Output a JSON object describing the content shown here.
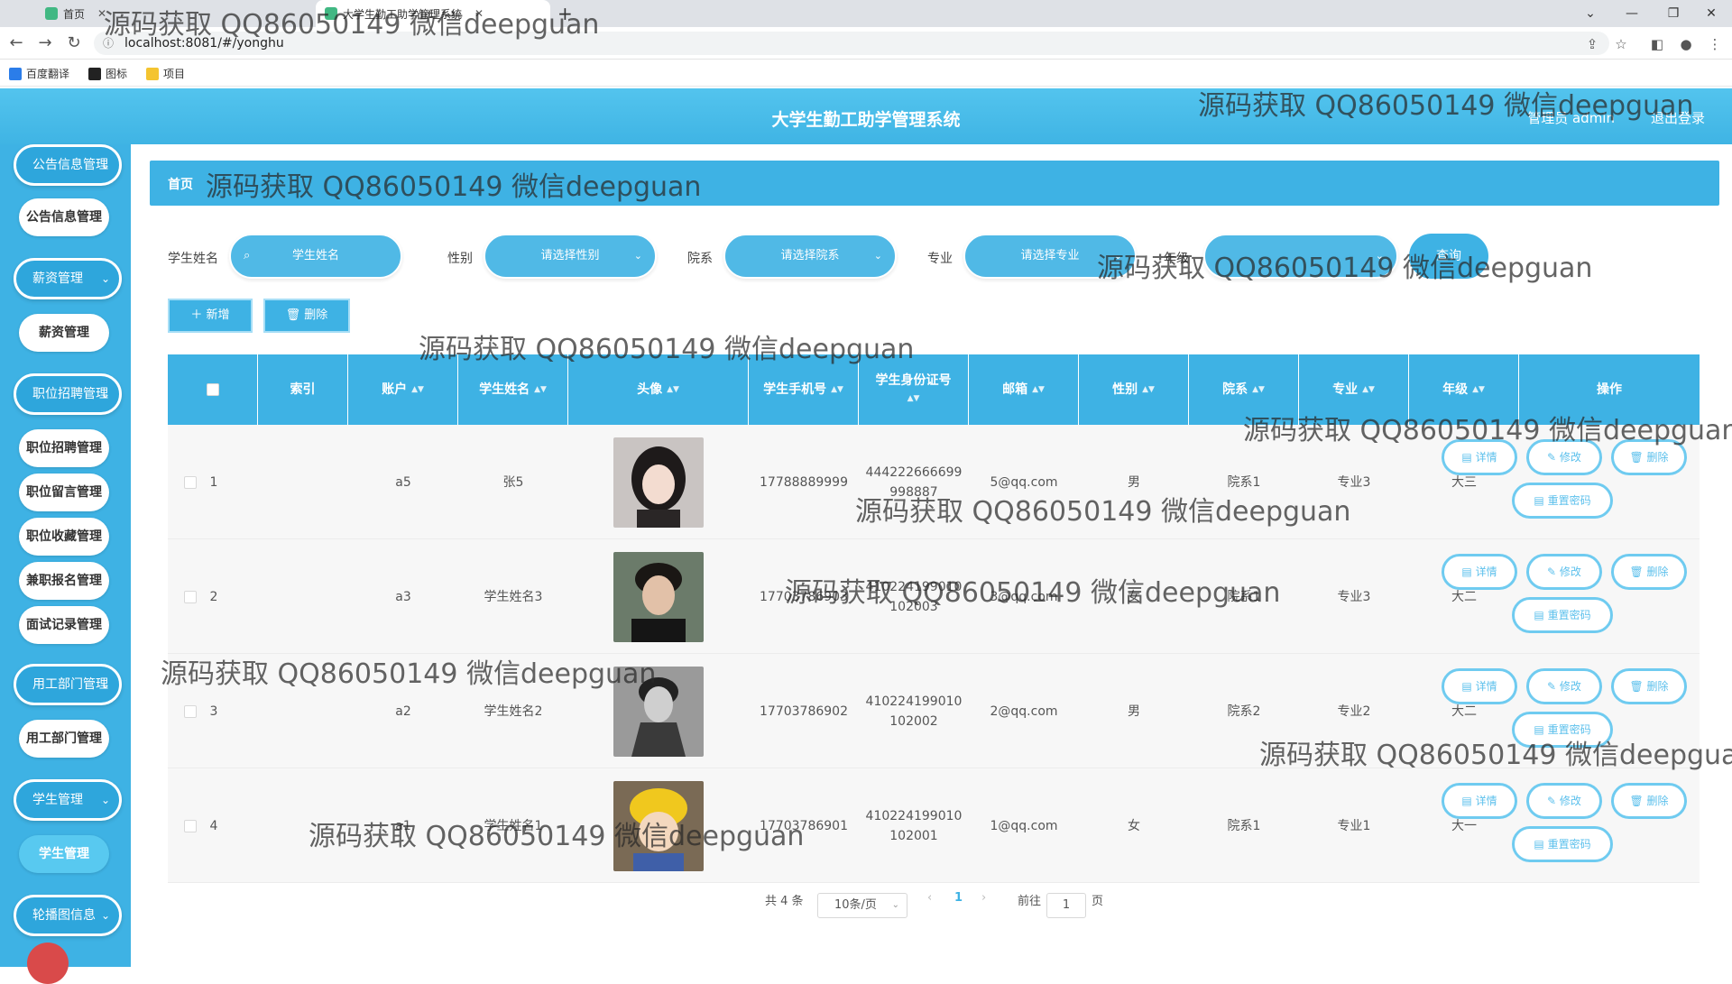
{
  "browser": {
    "tabs": [
      {
        "label": "首页",
        "active": false
      },
      {
        "label": "大学生勤工助学管理系统",
        "active": true
      }
    ],
    "url": "localhost:8081/#/yonghu",
    "bookmarks": [
      "百度翻译",
      "图标",
      "项目"
    ]
  },
  "header": {
    "title": "大学生勤工助学管理系统",
    "user": "管理员 admin",
    "logout": "退出登录"
  },
  "sidebar": {
    "groups": [
      {
        "label": "公告信息管理",
        "children": [
          "公告信息管理"
        ]
      },
      {
        "label": "薪资管理",
        "children": [
          "薪资管理"
        ]
      },
      {
        "label": "职位招聘管理",
        "children": [
          "职位招聘管理",
          "职位留言管理",
          "职位收藏管理",
          "兼职报名管理",
          "面试记录管理"
        ]
      },
      {
        "label": "用工部门管理",
        "children": [
          "用工部门管理"
        ]
      },
      {
        "label": "学生管理",
        "children": [
          "学生管理"
        ]
      },
      {
        "label": "轮播图信息",
        "children": []
      }
    ]
  },
  "breadcrumb": {
    "home": "首页"
  },
  "search": {
    "fields": [
      {
        "label": "学生姓名",
        "placeholder": "学生姓名"
      },
      {
        "label": "性别",
        "placeholder": "请选择性别"
      },
      {
        "label": "院系",
        "placeholder": "请选择院系"
      },
      {
        "label": "专业",
        "placeholder": "请选择专业"
      },
      {
        "label": "年级",
        "placeholder": ""
      }
    ],
    "button": "查询"
  },
  "actions": {
    "add": "＋ 新增",
    "delete": "🗑 删除"
  },
  "table": {
    "headers": [
      "索引",
      "账户",
      "学生姓名",
      "头像",
      "学生手机号",
      "学生身份证号",
      "邮箱",
      "性别",
      "院系",
      "专业",
      "年级",
      "操作"
    ],
    "rows": [
      {
        "index": "1",
        "account": "a5",
        "name": "张5",
        "phone": "17788889999",
        "idcard": [
          "444222666699",
          "998887"
        ],
        "email": "5@qq.com",
        "gender": "男",
        "dept": "院系1",
        "major": "专业3",
        "grade": "大三"
      },
      {
        "index": "2",
        "account": "a3",
        "name": "学生姓名3",
        "phone": "17703786903",
        "idcard": [
          "410224199010",
          "102003"
        ],
        "email": "3@qq.com",
        "gender": "女",
        "dept": "院系1",
        "major": "专业3",
        "grade": "大二"
      },
      {
        "index": "3",
        "account": "a2",
        "name": "学生姓名2",
        "phone": "17703786902",
        "idcard": [
          "410224199010",
          "102002"
        ],
        "email": "2@qq.com",
        "gender": "男",
        "dept": "院系2",
        "major": "专业2",
        "grade": "大二"
      },
      {
        "index": "4",
        "account": "a1",
        "name": "学生姓名1",
        "phone": "17703786901",
        "idcard": [
          "410224199010",
          "102001"
        ],
        "email": "1@qq.com",
        "gender": "女",
        "dept": "院系1",
        "major": "专业1",
        "grade": "大一"
      }
    ],
    "row_actions": {
      "detail": "详情",
      "edit": "修改",
      "delete": "删除",
      "reset": "重置密码"
    }
  },
  "pagination": {
    "total": "共 4 条",
    "page_size": "10条/页",
    "current": "1",
    "goto_prefix": "前往",
    "goto_value": "1",
    "goto_suffix": "页"
  },
  "watermark": "源码获取 QQ86050149 微信deepguan",
  "colors": {
    "primary": "#3eb2e4",
    "sidebar": "#3eb2e4",
    "text": "#555555"
  }
}
